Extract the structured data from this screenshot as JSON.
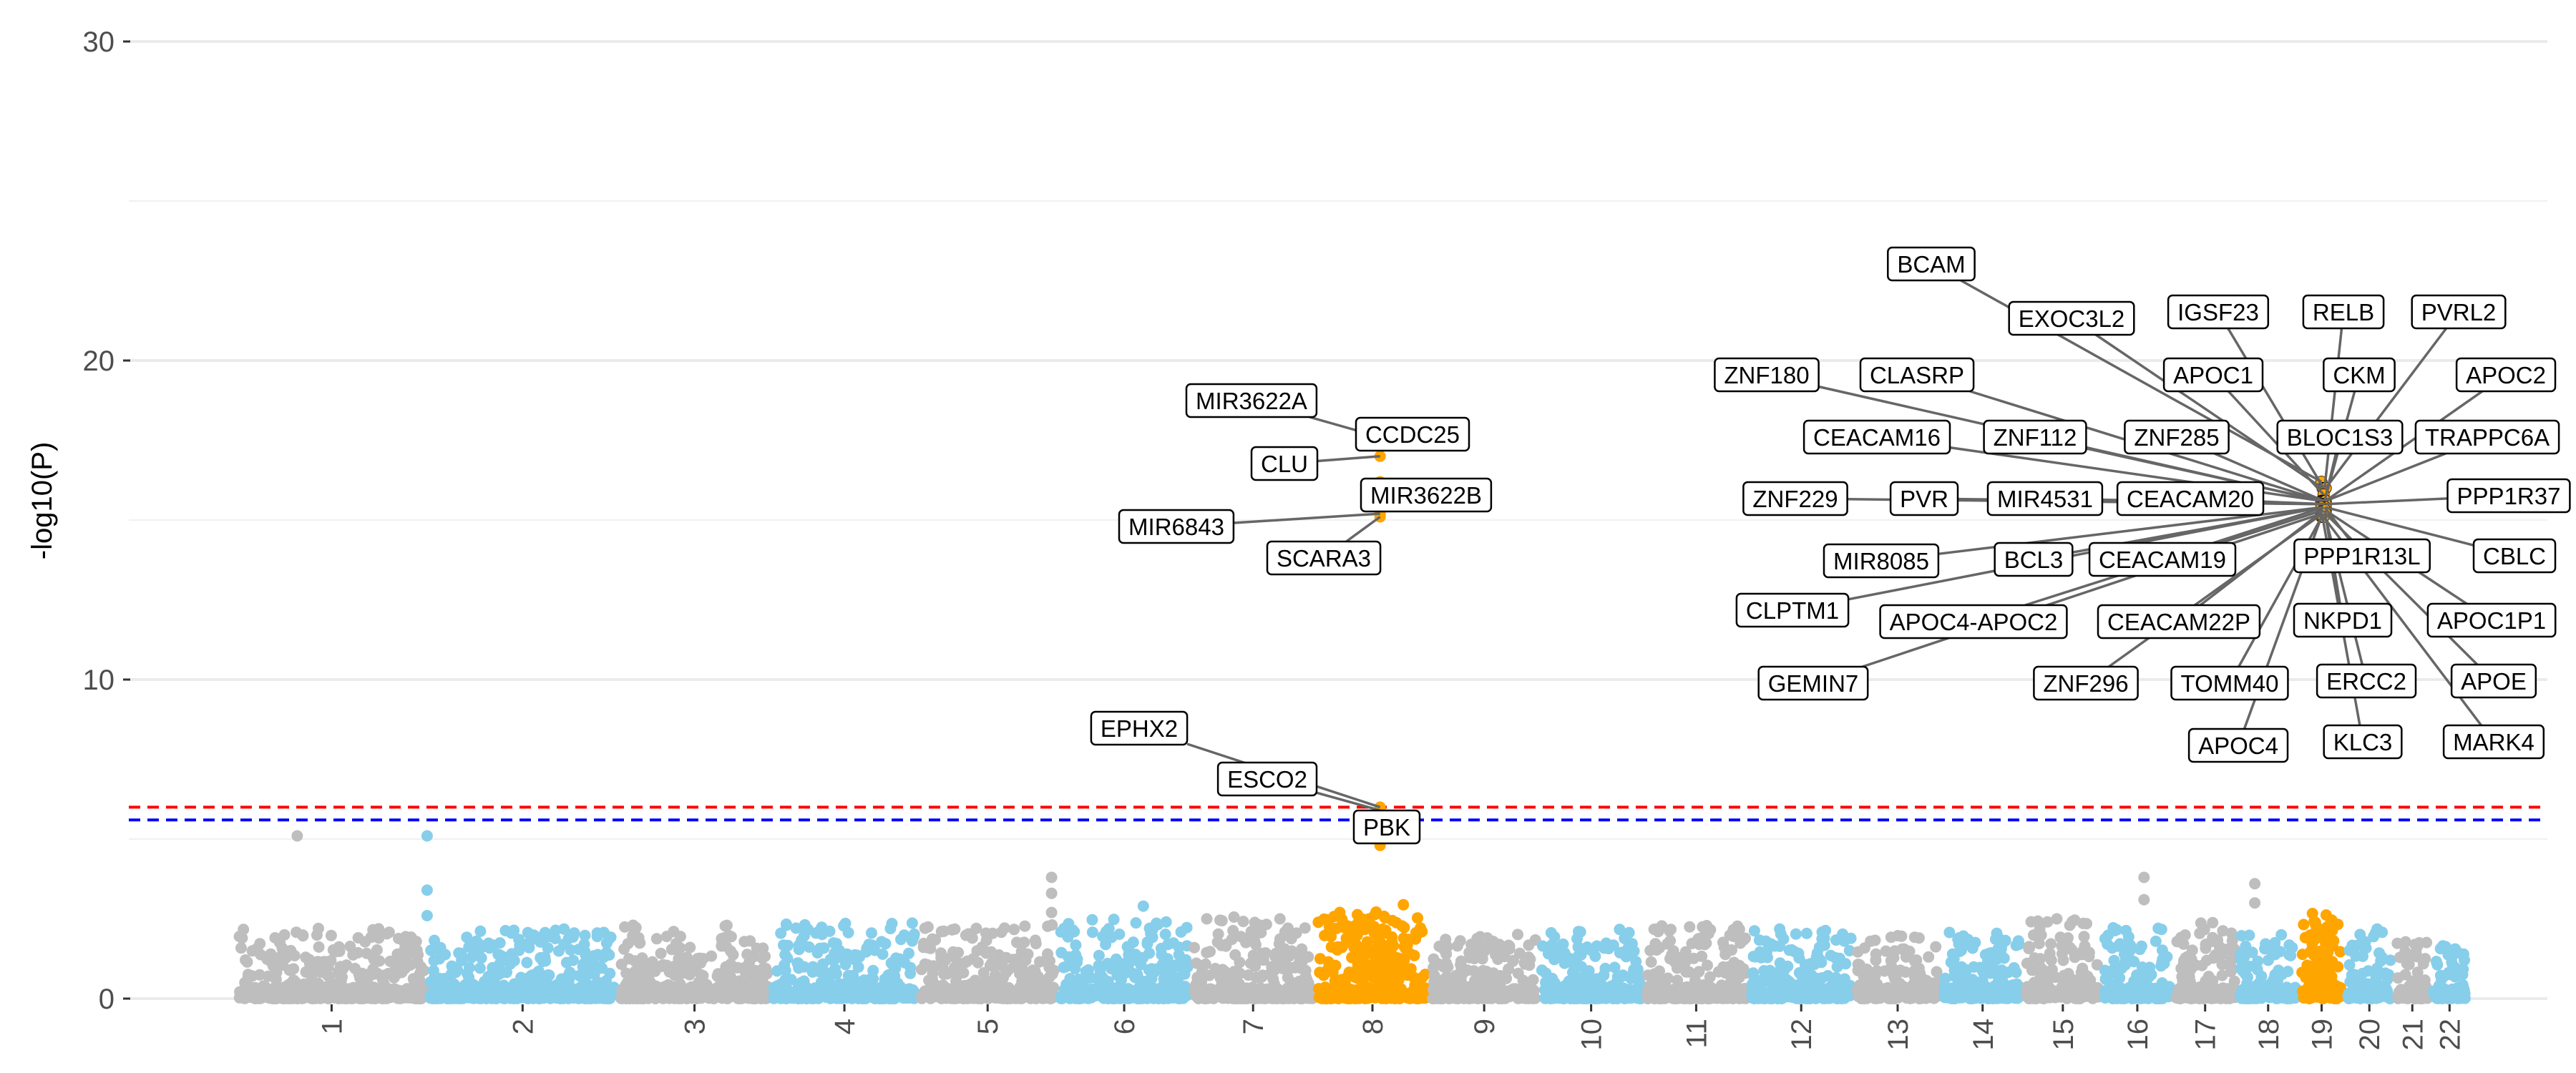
{
  "chart_data": {
    "type": "scatter",
    "subtype": "manhattan",
    "title": "",
    "xlabel": "",
    "ylabel": "-log10(P)",
    "ylim": [
      0,
      30
    ],
    "yticks": [
      0,
      10,
      20,
      30
    ],
    "grid": true,
    "legend": "none",
    "colors": {
      "odd_chromosomes": "#bebebe",
      "even_chromosomes": "#87ceeb",
      "highlighted_loci": "#ffa500",
      "suggestive_line": "#0000ff",
      "significance_line": "#ff0000",
      "label_leader": "#666666"
    },
    "threshold_lines": [
      {
        "name": "genome-wide significance",
        "y": 6.0,
        "color": "#ff0000",
        "style": "dashed"
      },
      {
        "name": "suggestive",
        "y": 5.6,
        "color": "#0000ff",
        "style": "dashed"
      }
    ],
    "chromosomes": [
      {
        "label": "1",
        "start": 0.0,
        "length": 1.0,
        "peak": 2.2
      },
      {
        "label": "2",
        "start": 1.0,
        "length": 1.0,
        "peak": 2.2
      },
      {
        "label": "3",
        "start": 2.0,
        "length": 0.8,
        "peak": 2.3
      },
      {
        "label": "4",
        "start": 2.8,
        "length": 0.77,
        "peak": 2.4
      },
      {
        "label": "5",
        "start": 3.57,
        "length": 0.73,
        "peak": 2.4
      },
      {
        "label": "6",
        "start": 4.3,
        "length": 0.7,
        "peak": 2.5
      },
      {
        "label": "7",
        "start": 5.0,
        "length": 0.65,
        "peak": 2.6
      },
      {
        "label": "8",
        "start": 5.65,
        "length": 0.6,
        "peak": 2.6
      },
      {
        "label": "9",
        "start": 6.25,
        "length": 0.57,
        "peak": 2.2
      },
      {
        "label": "10",
        "start": 6.82,
        "length": 0.55,
        "peak": 2.2
      },
      {
        "label": "11",
        "start": 7.37,
        "length": 0.55,
        "peak": 2.3
      },
      {
        "label": "12",
        "start": 7.92,
        "length": 0.55,
        "peak": 2.2
      },
      {
        "label": "13",
        "start": 8.47,
        "length": 0.46,
        "peak": 2.0
      },
      {
        "label": "14",
        "start": 8.93,
        "length": 0.43,
        "peak": 2.1
      },
      {
        "label": "15",
        "start": 9.36,
        "length": 0.41,
        "peak": 2.5
      },
      {
        "label": "16",
        "start": 9.77,
        "length": 0.37,
        "peak": 2.3
      },
      {
        "label": "17",
        "start": 10.14,
        "length": 0.34,
        "peak": 2.4
      },
      {
        "label": "18",
        "start": 10.48,
        "length": 0.32,
        "peak": 2.0
      },
      {
        "label": "19",
        "start": 10.8,
        "length": 0.24,
        "peak": 2.4
      },
      {
        "label": "20",
        "start": 11.04,
        "length": 0.26,
        "peak": 2.2
      },
      {
        "label": "21",
        "start": 11.3,
        "length": 0.19,
        "peak": 1.8
      },
      {
        "label": "22",
        "start": 11.49,
        "length": 0.2,
        "peak": 1.8
      }
    ],
    "highlighted_chromosome_regions": [
      {
        "chromosome": "8",
        "from": 5.65,
        "to": 6.25,
        "peak": 3.0
      },
      {
        "chromosome": "19",
        "from": 10.8,
        "to": 11.04,
        "peak": 2.8
      }
    ],
    "isolated_points": [
      {
        "x": 0.32,
        "y": 5.1,
        "chromosome": "1"
      },
      {
        "x": 1.0,
        "y": 5.1,
        "chromosome": "2"
      },
      {
        "x": 1.0,
        "y": 3.4,
        "chromosome": "2"
      },
      {
        "x": 1.0,
        "y": 2.6,
        "chromosome": "2"
      },
      {
        "x": 4.27,
        "y": 3.8,
        "chromosome": "5"
      },
      {
        "x": 4.27,
        "y": 3.3,
        "chromosome": "5"
      },
      {
        "x": 4.27,
        "y": 2.7,
        "chromosome": "5"
      },
      {
        "x": 4.75,
        "y": 2.9,
        "chromosome": "6"
      },
      {
        "x": 9.99,
        "y": 3.8,
        "chromosome": "15"
      },
      {
        "x": 9.99,
        "y": 3.1,
        "chromosome": "15"
      },
      {
        "x": 10.57,
        "y": 3.6,
        "chromosome": "17"
      },
      {
        "x": 10.57,
        "y": 3.0,
        "chromosome": "17"
      }
    ],
    "annotated_loci": [
      {
        "chromosome": "8",
        "x": 5.99,
        "genes": [
          {
            "label": "MIR3622A",
            "y": 17.6
          },
          {
            "label": "CCDC25",
            "y": 17.5
          },
          {
            "label": "CLU",
            "y": 17.0
          },
          {
            "label": "MIR3622B",
            "y": 16.2
          },
          {
            "label": "MIR6843",
            "y": 15.2
          },
          {
            "label": "SCARA3",
            "y": 15.1
          },
          {
            "label": "EPHX2",
            "y": 6.0
          },
          {
            "label": "ESCO2",
            "y": 5.9
          },
          {
            "label": "PBK",
            "y": 5.1
          }
        ],
        "extra_points": [
          4.8,
          5.4
        ]
      },
      {
        "chromosome": "19",
        "x": 10.93,
        "genes": [
          {
            "label": "BCAM",
            "y": 16.2
          },
          {
            "label": "EXOC3L2",
            "y": 16.0
          },
          {
            "label": "IGSF23",
            "y": 16.0
          },
          {
            "label": "RELB",
            "y": 16.0
          },
          {
            "label": "PVRL2",
            "y": 16.0
          },
          {
            "label": "ZNF180",
            "y": 15.6
          },
          {
            "label": "CLASRP",
            "y": 15.6
          },
          {
            "label": "APOC1",
            "y": 15.8
          },
          {
            "label": "CKM",
            "y": 15.6
          },
          {
            "label": "APOC2",
            "y": 15.6
          },
          {
            "label": "CEACAM16",
            "y": 15.6
          },
          {
            "label": "ZNF112",
            "y": 15.6
          },
          {
            "label": "ZNF285",
            "y": 15.6
          },
          {
            "label": "BLOC1S3",
            "y": 15.6
          },
          {
            "label": "TRAPPC6A",
            "y": 15.6
          },
          {
            "label": "ZNF229",
            "y": 15.5
          },
          {
            "label": "PVR",
            "y": 15.5
          },
          {
            "label": "MIR4531",
            "y": 15.5
          },
          {
            "label": "CEACAM20",
            "y": 15.5
          },
          {
            "label": "PPP1R37",
            "y": 15.5
          },
          {
            "label": "MIR8085",
            "y": 15.4
          },
          {
            "label": "BCL3",
            "y": 15.4
          },
          {
            "label": "CEACAM19",
            "y": 15.4
          },
          {
            "label": "PPP1R13L",
            "y": 15.4
          },
          {
            "label": "CBLC",
            "y": 15.4
          },
          {
            "label": "CLPTM1",
            "y": 15.4
          },
          {
            "label": "APOC4-APOC2",
            "y": 15.3
          },
          {
            "label": "CEACAM22P",
            "y": 15.3
          },
          {
            "label": "NKPD1",
            "y": 15.3
          },
          {
            "label": "APOC1P1",
            "y": 15.3
          },
          {
            "label": "GEMIN7",
            "y": 15.2
          },
          {
            "label": "ZNF296",
            "y": 15.2
          },
          {
            "label": "TOMM40",
            "y": 15.2
          },
          {
            "label": "ERCC2",
            "y": 15.2
          },
          {
            "label": "APOE",
            "y": 15.2
          },
          {
            "label": "APOC4",
            "y": 15.1
          },
          {
            "label": "KLC3",
            "y": 15.1
          },
          {
            "label": "MARK4",
            "y": 15.1
          }
        ]
      }
    ]
  }
}
